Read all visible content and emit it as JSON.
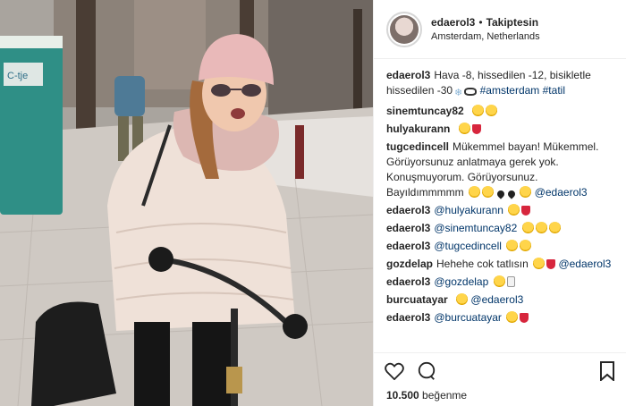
{
  "post": {
    "username": "edaerol3",
    "separator": "•",
    "follow_state": "Takiptesin",
    "location": "Amsterdam, Netherlands",
    "caption": {
      "user": "edaerol3",
      "text": "Hava -8, hissedilen -12, bisikletle hissedilen -30",
      "snow": "❄",
      "hashtags": "#amsterdam #tatil"
    },
    "photo": {
      "sign_text": "C-tje"
    }
  },
  "comments": [
    {
      "user": "sinemtuncay82",
      "text": ""
    },
    {
      "user": "hulyakurann",
      "text": ""
    },
    {
      "user": "tugcedincell",
      "text": "Mükemmel bayan! Mükemmel. Görüyorsunuz anlatmaya gerek yok. Konuşmuyorum. Görüyorsunuz. Bayıldımmmmm",
      "mention": "@edaerol3"
    },
    {
      "user": "edaerol3",
      "mention": "@hulyakurann"
    },
    {
      "user": "edaerol3",
      "mention": "@sinemtuncay82"
    },
    {
      "user": "edaerol3",
      "mention": "@tugcedincell"
    },
    {
      "user": "gozdelap",
      "text": "Hehehe cok tatlısın",
      "mention": "@edaerol3"
    },
    {
      "user": "edaerol3",
      "mention": "@gozdelap"
    },
    {
      "user": "burcuatayar",
      "mention": "@edaerol3"
    },
    {
      "user": "edaerol3",
      "mention": "@burcuatayar"
    }
  ],
  "actions": {
    "like_icon": "heart-icon",
    "comment_icon": "comment-icon",
    "save_icon": "bookmark-icon",
    "likes_count": "10.500",
    "likes_label": "beğenme"
  },
  "colors": {
    "mention": "#003569",
    "text": "#262626",
    "border": "#efefef"
  }
}
